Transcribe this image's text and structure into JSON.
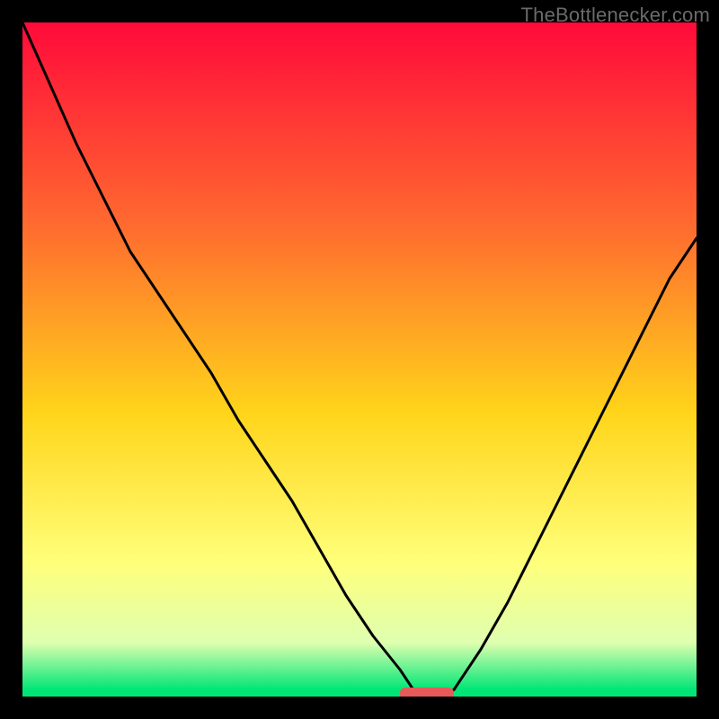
{
  "watermark": "TheBottlenecker.com",
  "colors": {
    "top": "#ff0a3a",
    "mid_upper": "#ff6a2f",
    "mid": "#ffd51a",
    "mid_lower": "#ffff7a",
    "lower": "#dfffb0",
    "bottom": "#00e676",
    "curve": "#000000",
    "marker": "#e65a5a"
  },
  "chart_data": {
    "type": "line",
    "title": "",
    "xlabel": "",
    "ylabel": "",
    "xlim": [
      0,
      100
    ],
    "ylim": [
      0,
      100
    ],
    "x": [
      0,
      4,
      8,
      12,
      16,
      20,
      24,
      28,
      32,
      36,
      40,
      44,
      48,
      52,
      56,
      58,
      60,
      62,
      64,
      68,
      72,
      76,
      80,
      84,
      88,
      92,
      96,
      100
    ],
    "y": [
      100,
      91,
      82,
      74,
      66,
      60,
      54,
      48,
      41,
      35,
      29,
      22,
      15,
      9,
      4,
      1,
      0,
      0,
      1,
      7,
      14,
      22,
      30,
      38,
      46,
      54,
      62,
      68
    ],
    "optimal_x": [
      56,
      64
    ],
    "optimal_y": 0
  }
}
